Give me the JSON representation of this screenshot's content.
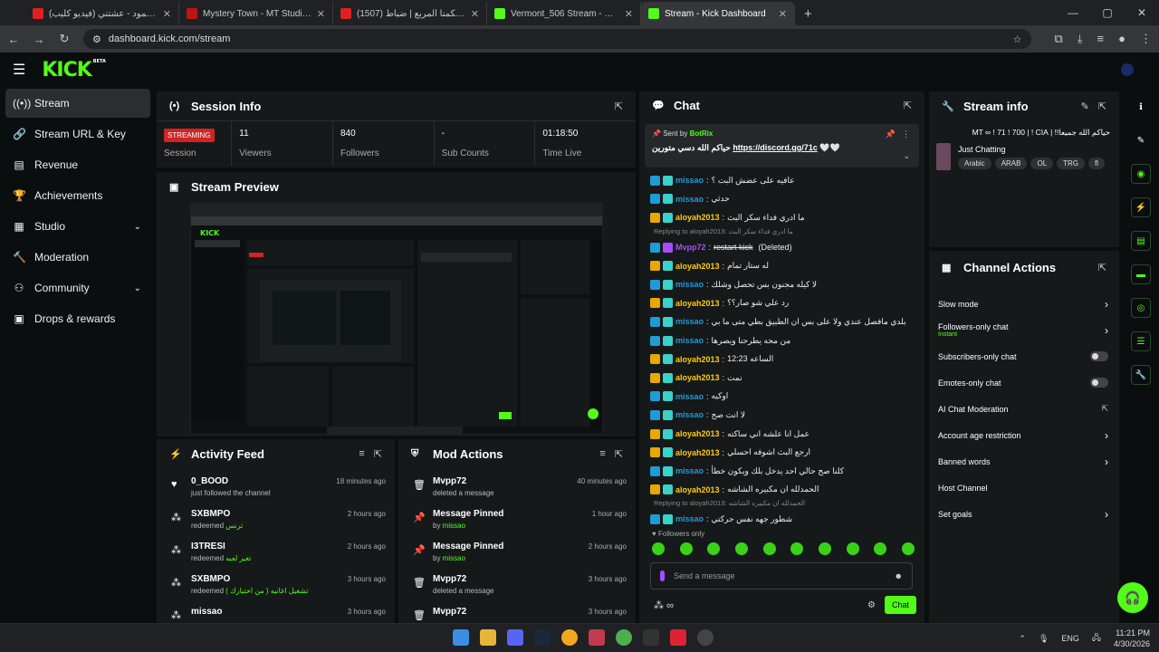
{
  "browser": {
    "tabs": [
      {
        "label": "صباح محمود - عشتني (فيديو كليب)",
        "color": "#e02020"
      },
      {
        "label": "Mystery Town - MT Studios | M",
        "color": "#c01515"
      },
      {
        "label": "(1507) شيلة حكمنا المربع | ضباط",
        "color": "#e02020"
      },
      {
        "label": "Vermont_506 Stream - Watch Li",
        "color": "#53fc18"
      },
      {
        "label": "Stream - Kick Dashboard",
        "color": "#53fc18"
      }
    ],
    "url": "dashboard.kick.com/stream"
  },
  "brand": {
    "logo": "KICK",
    "beta": "BETA",
    "accent": "#53fc18"
  },
  "sidebar": {
    "items": [
      {
        "label": "Stream",
        "icon": "broadcast-icon",
        "glyph": "((•))"
      },
      {
        "label": "Stream URL & Key",
        "icon": "link-icon",
        "glyph": "🔗"
      },
      {
        "label": "Revenue",
        "icon": "chart-icon",
        "glyph": "▤"
      },
      {
        "label": "Achievements",
        "icon": "trophy-icon",
        "glyph": "🏆"
      },
      {
        "label": "Studio",
        "icon": "studio-icon",
        "glyph": "▦"
      },
      {
        "label": "Moderation",
        "icon": "hammer-icon",
        "glyph": "🔨"
      },
      {
        "label": "Community",
        "icon": "community-icon",
        "glyph": "⚇"
      },
      {
        "label": "Drops & rewards",
        "icon": "gift-icon",
        "glyph": "▣"
      }
    ]
  },
  "session": {
    "title": "Session Info",
    "status": "STREAMING",
    "status_label": "Session",
    "stats": [
      {
        "value": "11",
        "label": "Viewers"
      },
      {
        "value": "840",
        "label": "Followers"
      },
      {
        "value": "-",
        "label": "Sub Counts"
      },
      {
        "value": "01:18:50",
        "label": "Time Live"
      }
    ]
  },
  "preview": {
    "title": "Stream Preview"
  },
  "activity": {
    "title": "Activity Feed",
    "items": [
      {
        "name": "0_BOOD",
        "sub": "just followed the channel",
        "reward": "",
        "time": "18 minutes ago",
        "icon": "heart-icon",
        "glyph": "♥"
      },
      {
        "name": "SXBMPO",
        "sub": "redeemed",
        "reward": "ترنس",
        "time": "2 hours ago",
        "icon": "points-icon",
        "glyph": "⁂"
      },
      {
        "name": "I3TRESI",
        "sub": "redeemed",
        "reward": "تغير لعبه",
        "time": "2 hours ago",
        "icon": "points-icon",
        "glyph": "⁂"
      },
      {
        "name": "SXBMPO",
        "sub": "redeemed",
        "reward": "تشغيل اغانيه ( من اختيارك )",
        "time": "3 hours ago",
        "icon": "points-icon",
        "glyph": "⁂"
      },
      {
        "name": "missao",
        "sub": "",
        "reward": "",
        "time": "3 hours ago",
        "icon": "points-icon",
        "glyph": "⁂"
      }
    ]
  },
  "modactions": {
    "title": "Mod Actions",
    "items": [
      {
        "name": "Mvpp72",
        "sub": "deleted a message",
        "by": "",
        "time": "40 minutes ago",
        "icon": "trash-icon",
        "glyph": "🗑"
      },
      {
        "name": "Message Pinned",
        "sub": "by ",
        "by": "missao",
        "time": "1 hour ago",
        "icon": "pin-icon",
        "glyph": "📌"
      },
      {
        "name": "Message Pinned",
        "sub": "by ",
        "by": "missao",
        "time": "2 hours ago",
        "icon": "pin-icon",
        "glyph": "📌"
      },
      {
        "name": "Mvpp72",
        "sub": "deleted a message",
        "by": "",
        "time": "3 hours ago",
        "icon": "trash-icon",
        "glyph": "🗑"
      },
      {
        "name": "Mvpp72",
        "sub": "",
        "by": "",
        "time": "3 hours ago",
        "icon": "trash-icon",
        "glyph": "🗑"
      }
    ]
  },
  "chat": {
    "title": "Chat",
    "pinned": {
      "sent_by": "Sent by",
      "user": "BotRix",
      "text": "حياكم الله دسي متورين",
      "link": "https://discord.gg/71c"
    },
    "messages": [
      {
        "user": "missao",
        "color": "#1f9bd8",
        "text": "عافيه على عضش البت ؟",
        "reply": ""
      },
      {
        "user": "missao",
        "color": "#1f9bd8",
        "text": "حدثي",
        "reply": ""
      },
      {
        "user": "aloyah2013",
        "color": "#ffcc00",
        "text": "ما ادري فداء سكر البث",
        "reply": ""
      },
      {
        "user": "Mvpp72",
        "color": "#a94cff",
        "text": "restart kick",
        "reply": "Replying to aloyah2013: ما ادري فداء سكر البث",
        "deleted": "(Deleted)"
      },
      {
        "user": "aloyah2013",
        "color": "#ffcc00",
        "text": "له ستار تمام",
        "reply": ""
      },
      {
        "user": "missao",
        "color": "#1f9bd8",
        "text": "لا كيله مجنون بس تحصل وشلك",
        "reply": ""
      },
      {
        "user": "aloyah2013",
        "color": "#ffcc00",
        "text": "رد علي شو صار؟؟",
        "reply": ""
      },
      {
        "user": "missao",
        "color": "#1f9bd8",
        "text": "بلدي مافصل عندي ولا على بس ان الطبيق بطي متى ما بي",
        "reply": ""
      },
      {
        "user": "missao",
        "color": "#1f9bd8",
        "text": "من محه يطرحنا ويصرها",
        "reply": ""
      },
      {
        "user": "aloyah2013",
        "color": "#ffcc00",
        "text": "الساعه 12:23",
        "reply": ""
      },
      {
        "user": "aloyah2013",
        "color": "#ffcc00",
        "text": "نمت",
        "reply": ""
      },
      {
        "user": "missao",
        "color": "#1f9bd8",
        "text": "اوكيه",
        "reply": ""
      },
      {
        "user": "missao",
        "color": "#1f9bd8",
        "text": "لا انت صح",
        "reply": ""
      },
      {
        "user": "aloyah2013",
        "color": "#ffcc00",
        "text": "عمل انا علشه اني ساكته",
        "reply": ""
      },
      {
        "user": "aloyah2013",
        "color": "#ffcc00",
        "text": "ارجع البث اشوفه احسلي",
        "reply": ""
      },
      {
        "user": "missao",
        "color": "#1f9bd8",
        "text": "كلنا صح حالي احد يدخل بلك ويكون خطأ",
        "reply": ""
      },
      {
        "user": "aloyah2013",
        "color": "#ffcc00",
        "text": "الحمدلله ان مكبيره الشاشه",
        "reply": ""
      },
      {
        "user": "missao",
        "color": "#1f9bd8",
        "text": "شطور جهه نفس حركتي",
        "reply": "Replying to aloyah2013: الحمدلله ان مكبيره الشاشه"
      }
    ],
    "followers_only": "Followers only",
    "placeholder": "Send a message",
    "send_label": "Chat",
    "points": "∞"
  },
  "streaminfo": {
    "title": "Stream info",
    "stream_title": "حياكم الله جميعا!! | MT ∞ ! 71 ! 700 | ! CIA",
    "category": "Just Chatting",
    "tags": [
      "Arabic",
      "ARAB",
      "OL",
      "TRG",
      "fl"
    ]
  },
  "channelactions": {
    "title": "Channel Actions",
    "items": [
      {
        "label": "Slow mode",
        "sub": "",
        "ctrl": "chevron"
      },
      {
        "label": "Followers-only chat",
        "sub": "Instant",
        "ctrl": "chevron"
      },
      {
        "label": "Subscribers-only chat",
        "sub": "",
        "ctrl": "toggle"
      },
      {
        "label": "Emotes-only chat",
        "sub": "",
        "ctrl": "toggle"
      },
      {
        "label": "AI Chat Moderation",
        "sub": "",
        "ctrl": "external"
      },
      {
        "label": "Account age restriction",
        "sub": "",
        "ctrl": "chevron"
      },
      {
        "label": "Banned words",
        "sub": "",
        "ctrl": "chevron"
      },
      {
        "label": "Host Channel",
        "sub": "",
        "ctrl": "none"
      },
      {
        "label": "Set goals",
        "sub": "",
        "ctrl": "chevron"
      }
    ]
  },
  "taskbar": {
    "lang": "ENG",
    "time": "11:21 PM",
    "date": "4/30/2026"
  }
}
